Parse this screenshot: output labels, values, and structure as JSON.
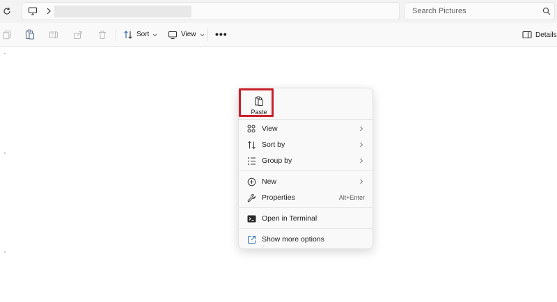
{
  "search": {
    "placeholder": "Search Pictures"
  },
  "toolbar": {
    "sort_label": "Sort",
    "view_label": "View",
    "more_label": "•••",
    "details_label": "Details"
  },
  "context_menu": {
    "paste_label": "Paste",
    "items": [
      {
        "label": "View",
        "icon": "grid-view-icon",
        "submenu": true
      },
      {
        "label": "Sort by",
        "icon": "sort-icon",
        "submenu": true
      },
      {
        "label": "Group by",
        "icon": "group-by-icon",
        "submenu": true
      },
      {
        "label": "New",
        "icon": "plus-circle-icon",
        "submenu": true
      },
      {
        "label": "Properties",
        "icon": "wrench-icon",
        "shortcut": "Alt+Enter"
      },
      {
        "label": "Open in Terminal",
        "icon": "terminal-icon"
      },
      {
        "label": "Show more options",
        "icon": "share-open-icon"
      }
    ]
  },
  "colors": {
    "highlight": "#c8202a",
    "background": "#ffffff",
    "toolbar": "#f9f9f9"
  }
}
